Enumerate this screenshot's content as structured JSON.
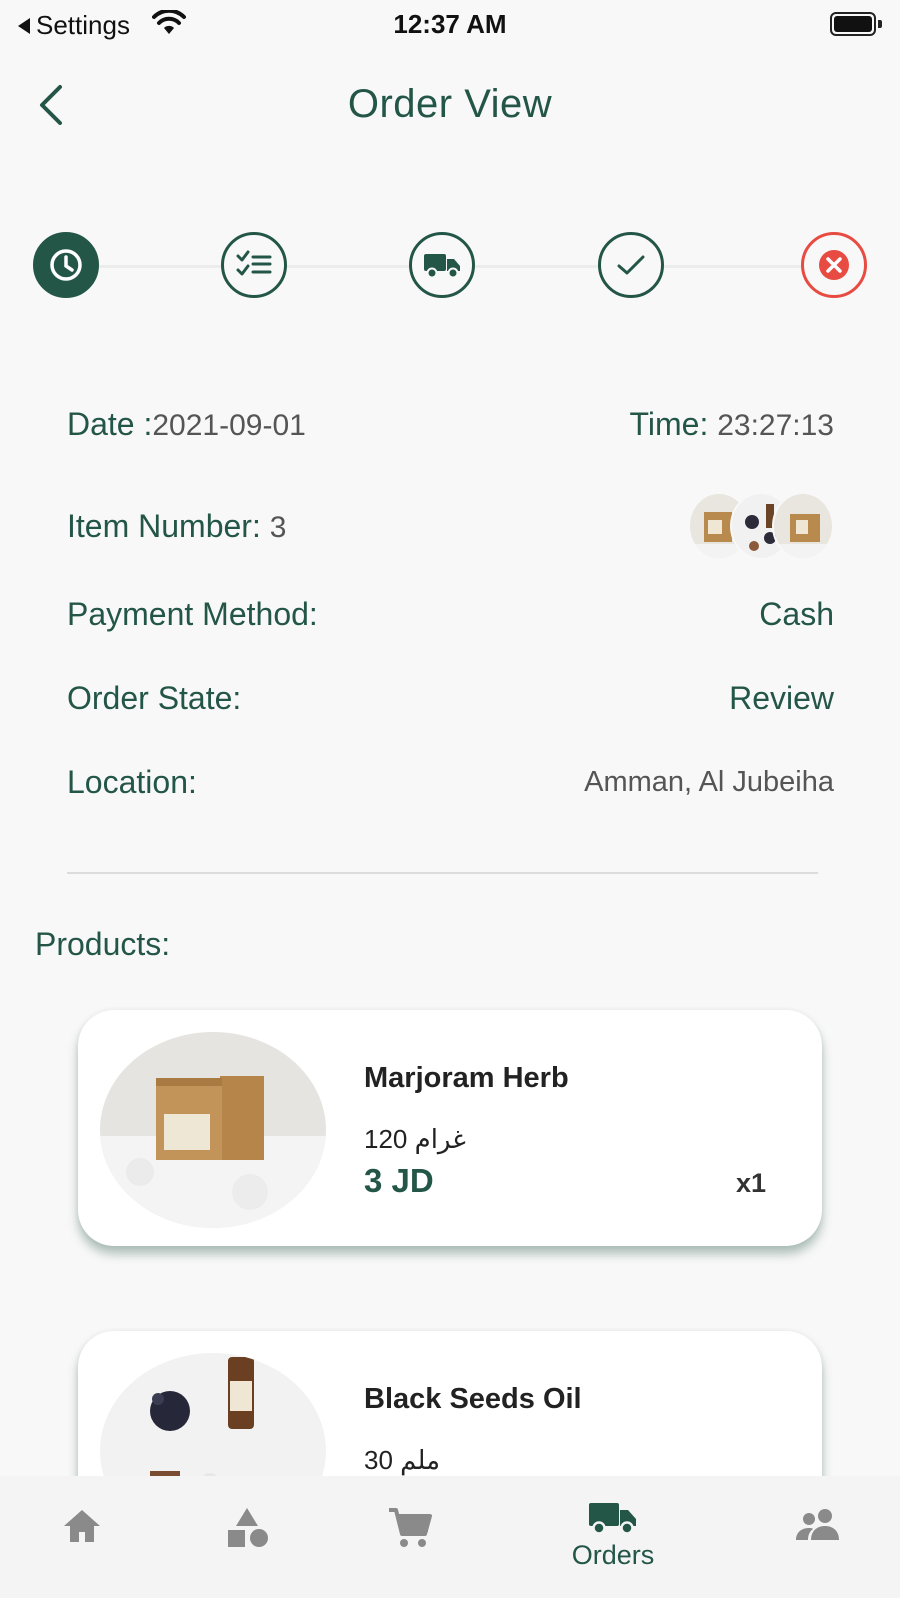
{
  "status_bar": {
    "back_app": "Settings",
    "time": "12:37 AM"
  },
  "header": {
    "title": "Order View"
  },
  "stepper": {
    "steps": [
      {
        "icon": "clock-icon",
        "state": "active"
      },
      {
        "icon": "checklist-icon",
        "state": "pending"
      },
      {
        "icon": "truck-icon",
        "state": "pending"
      },
      {
        "icon": "check-icon",
        "state": "pending"
      },
      {
        "icon": "cancel-icon",
        "state": "cancel"
      }
    ],
    "colors": {
      "primary": "#245648",
      "cancel": "#e74b42"
    }
  },
  "order": {
    "date_label": "Date :",
    "date_value": "2021-09-01",
    "time_label": "Time:",
    "time_value": "23:27:13",
    "item_number_label": "Item Number:",
    "item_number_value": "3",
    "payment_label": "Payment Method:",
    "payment_value": "Cash",
    "state_label": "Order State:",
    "state_value": "Review",
    "location_label": "Location:",
    "location_value": "Amman, Al Jubeiha"
  },
  "products": {
    "label": "Products:",
    "items": [
      {
        "name": "Marjoram Herb",
        "weight": "120 غرام",
        "price": "3 JD",
        "qty": "x1"
      },
      {
        "name": "Black Seeds Oil",
        "weight": "30 ملم"
      }
    ]
  },
  "bottom_nav": {
    "items": [
      {
        "icon": "home-icon",
        "label": ""
      },
      {
        "icon": "categories-icon",
        "label": ""
      },
      {
        "icon": "cart-icon",
        "label": ""
      },
      {
        "icon": "truck-icon",
        "label": "Orders",
        "active": true
      },
      {
        "icon": "people-icon",
        "label": ""
      }
    ]
  }
}
